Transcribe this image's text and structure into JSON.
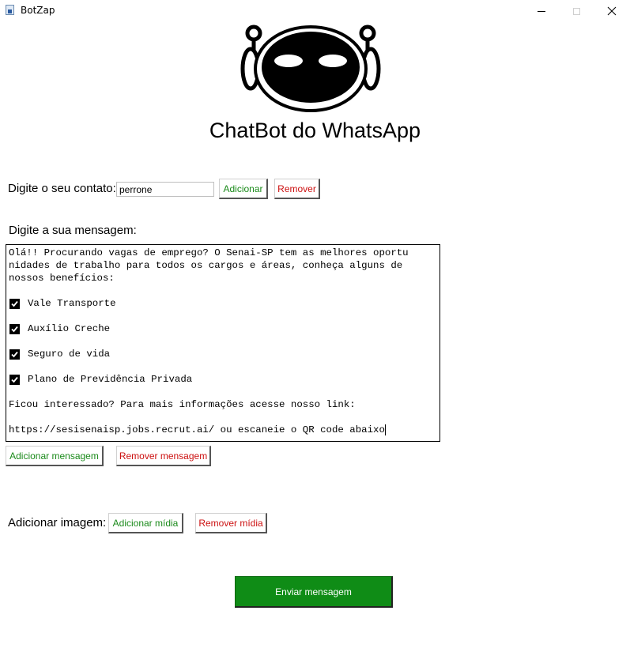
{
  "window": {
    "title": "BotZap",
    "controls": [
      "minimize",
      "maximize",
      "close"
    ]
  },
  "header": {
    "logo_icon": "robot-icon",
    "title": "ChatBot do WhatsApp"
  },
  "contact": {
    "label": "Digite o seu contato:",
    "value": "perrone",
    "add_label": "Adicionar",
    "remove_label": "Remover"
  },
  "message": {
    "label": "Digite a sua mensagem:",
    "lines": [
      "Olá!! Procurando vagas de emprego? O Senai-SP tem as melhores oportu",
      "nidades de trabalho para todos os cargos e áreas, conheça alguns de",
      "nossos benefícios:"
    ],
    "benefits": [
      "Vale Transporte",
      "Auxílio Creche",
      "Seguro de vida",
      "Plano de Previdência Privada"
    ],
    "closing": "Ficou interessado? Para mais informações acesse nosso link:",
    "link_line": "https://sesisenaisp.jobs.recrut.ai/ ou escaneie o QR code abaixo",
    "add_label": "Adicionar mensagem",
    "remove_label": "Remover mensagem"
  },
  "media": {
    "label": "Adicionar imagem:",
    "add_label": "Adicionar mídia",
    "remove_label": "Remover mídia"
  },
  "send": {
    "label": "Enviar mensagem"
  },
  "colors": {
    "add_text": "#1a8a1a",
    "remove_text": "#cc1010",
    "send_bg": "#0f8c16"
  }
}
